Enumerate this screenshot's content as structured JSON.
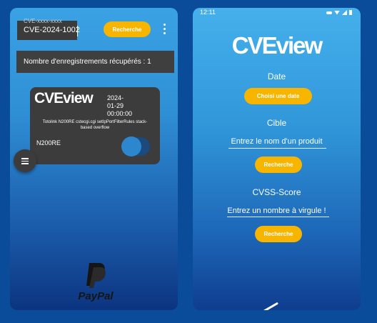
{
  "left_screen": {
    "search": {
      "placeholder": "CVE-xxxx-xxxx",
      "value": "CVE-2024-1002"
    },
    "search_button": "Recherche",
    "record_count": "Nombre d'enregistrements récupérés : 1",
    "card": {
      "logo": "CVEview",
      "date_lines": [
        "2024-",
        "01-29",
        "00:00:00"
      ],
      "description": "Totolink N200RE cstecgi.cgi setIpPortFilterRules stack-based overflow",
      "product": "N200RE",
      "toggle_on": true
    },
    "paypal_label": "PayPal"
  },
  "right_screen": {
    "status_time": "12:11",
    "logo": "CVEview",
    "date_title": "Date",
    "date_button": "Choisi une date",
    "target_title": "Cible",
    "target_placeholder": "Entrez le nom d'un produit",
    "target_button": "Recherche",
    "cvss_title": "CVSS-Score",
    "cvss_placeholder": "Entrez un nombre à virgule !",
    "cvss_button": "Recherche"
  },
  "colors": {
    "accent": "#f7b500",
    "card": "#3c3c3c",
    "background": "#0a4c9a"
  }
}
